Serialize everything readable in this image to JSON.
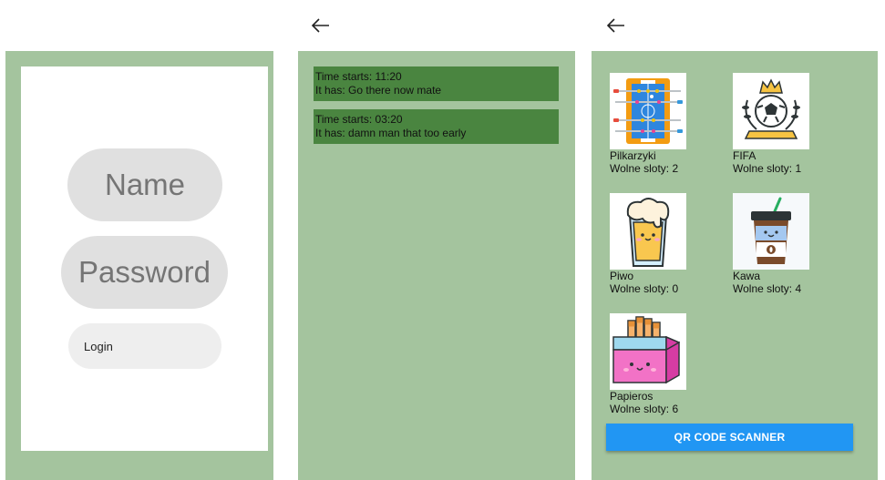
{
  "login_screen": {
    "name_placeholder": "Name",
    "password_placeholder": "Password",
    "login_label": "Login"
  },
  "events_screen": {
    "events": [
      {
        "time": "Time starts: 11:20",
        "text": "It has: Go there now mate"
      },
      {
        "time": "Time starts: 03:20",
        "text": "It has: damn man that too early"
      }
    ]
  },
  "items_screen": {
    "items": [
      {
        "name": "Pilkarzyki",
        "slots": "Wolne sloty: 2",
        "icon": "foosball-icon"
      },
      {
        "name": "FIFA",
        "slots": "Wolne sloty: 1",
        "icon": "soccer-trophy-icon"
      },
      {
        "name": "Piwo",
        "slots": "Wolne sloty: 0",
        "icon": "beer-icon"
      },
      {
        "name": "Kawa",
        "slots": "Wolne sloty: 4",
        "icon": "coffee-cup-icon"
      },
      {
        "name": "Papieros",
        "slots": "Wolne sloty: 6",
        "icon": "cigarette-pack-icon"
      }
    ],
    "qr_label": "QR CODE SCANNER"
  },
  "colors": {
    "background_green": "#a4c49e",
    "event_green": "#4a8540",
    "button_blue": "#2196f3"
  }
}
